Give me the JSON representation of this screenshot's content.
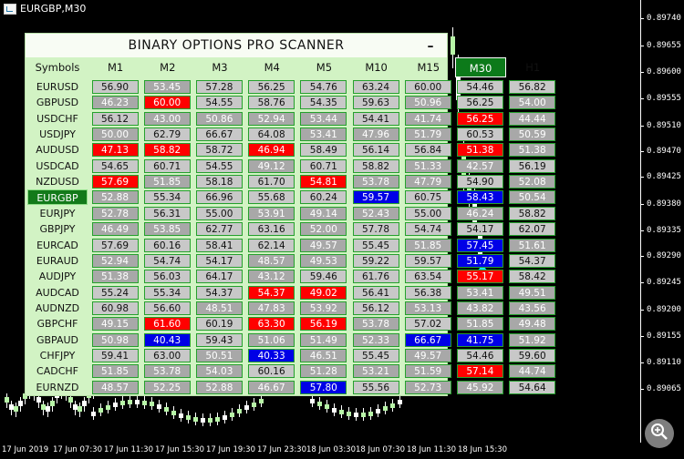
{
  "window": {
    "title": "EURGBP,M30"
  },
  "scanner": {
    "title": "BINARY OPTIONS PRO SCANNER",
    "minimize_label": "–",
    "symbols_header": "Symbols",
    "timeframes": [
      "M1",
      "M2",
      "M3",
      "M4",
      "M5",
      "M10",
      "M15",
      "M30",
      "H1"
    ],
    "active_timeframe": "M30",
    "active_symbol": "EURGBP",
    "rows": [
      {
        "symbol": "EURUSD",
        "values": [
          "56.90",
          "53.45",
          "57.28",
          "56.25",
          "54.76",
          "63.24",
          "60.00",
          "54.46",
          "56.82"
        ],
        "colors": [
          "L",
          "G",
          "L",
          "L",
          "L",
          "L",
          "L",
          "L",
          "L"
        ]
      },
      {
        "symbol": "GBPUSD",
        "values": [
          "46.23",
          "60.00",
          "54.55",
          "58.76",
          "54.35",
          "59.63",
          "50.96",
          "56.25",
          "54.00"
        ],
        "colors": [
          "G",
          "R",
          "L",
          "L",
          "L",
          "L",
          "G",
          "L",
          "G"
        ]
      },
      {
        "symbol": "USDCHF",
        "values": [
          "56.12",
          "43.00",
          "50.86",
          "52.94",
          "53.44",
          "54.41",
          "41.74",
          "56.25",
          "44.44"
        ],
        "colors": [
          "L",
          "G",
          "G",
          "G",
          "G",
          "L",
          "G",
          "R",
          "G"
        ]
      },
      {
        "symbol": "USDJPY",
        "values": [
          "50.00",
          "62.79",
          "66.67",
          "64.08",
          "53.41",
          "47.96",
          "51.79",
          "60.53",
          "50.59"
        ],
        "colors": [
          "G",
          "L",
          "L",
          "L",
          "G",
          "G",
          "G",
          "L",
          "G"
        ]
      },
      {
        "symbol": "AUDUSD",
        "values": [
          "47.13",
          "58.82",
          "58.72",
          "46.94",
          "58.49",
          "56.14",
          "56.84",
          "51.38",
          "51.38"
        ],
        "colors": [
          "R",
          "R",
          "L",
          "R",
          "L",
          "L",
          "L",
          "R",
          "G"
        ]
      },
      {
        "symbol": "USDCAD",
        "values": [
          "54.65",
          "60.71",
          "54.55",
          "49.12",
          "60.71",
          "58.82",
          "51.33",
          "42.57",
          "56.19"
        ],
        "colors": [
          "L",
          "L",
          "L",
          "G",
          "L",
          "L",
          "G",
          "G",
          "L"
        ]
      },
      {
        "symbol": "NZDUSD",
        "values": [
          "57.69",
          "51.85",
          "58.18",
          "61.70",
          "54.81",
          "53.78",
          "47.79",
          "54.90",
          "52.08"
        ],
        "colors": [
          "R",
          "G",
          "L",
          "L",
          "R",
          "G",
          "G",
          "L",
          "G"
        ]
      },
      {
        "symbol": "EURGBP",
        "values": [
          "52.88",
          "55.34",
          "66.96",
          "55.68",
          "60.24",
          "59.57",
          "60.75",
          "58.43",
          "50.54"
        ],
        "colors": [
          "G",
          "L",
          "L",
          "L",
          "L",
          "B",
          "L",
          "B",
          "G"
        ]
      },
      {
        "symbol": "EURJPY",
        "values": [
          "52.78",
          "56.31",
          "55.00",
          "53.91",
          "49.14",
          "52.43",
          "55.00",
          "46.24",
          "58.82"
        ],
        "colors": [
          "G",
          "L",
          "L",
          "G",
          "G",
          "G",
          "L",
          "G",
          "L"
        ]
      },
      {
        "symbol": "GBPJPY",
        "values": [
          "46.49",
          "53.85",
          "62.77",
          "63.16",
          "52.00",
          "57.78",
          "54.74",
          "54.17",
          "62.07"
        ],
        "colors": [
          "G",
          "G",
          "L",
          "L",
          "G",
          "L",
          "L",
          "L",
          "L"
        ]
      },
      {
        "symbol": "EURCAD",
        "values": [
          "57.69",
          "60.16",
          "58.41",
          "62.14",
          "49.57",
          "55.45",
          "51.85",
          "57.45",
          "51.61"
        ],
        "colors": [
          "L",
          "L",
          "L",
          "L",
          "G",
          "L",
          "G",
          "B",
          "G"
        ]
      },
      {
        "symbol": "EURAUD",
        "values": [
          "52.94",
          "54.74",
          "54.17",
          "48.57",
          "49.53",
          "59.22",
          "59.57",
          "51.79",
          "54.37"
        ],
        "colors": [
          "G",
          "L",
          "L",
          "G",
          "G",
          "L",
          "L",
          "B",
          "L"
        ]
      },
      {
        "symbol": "AUDJPY",
        "values": [
          "51.38",
          "56.03",
          "64.17",
          "43.12",
          "59.46",
          "61.76",
          "63.54",
          "55.17",
          "58.42"
        ],
        "colors": [
          "G",
          "L",
          "L",
          "G",
          "L",
          "L",
          "L",
          "R",
          "L"
        ]
      },
      {
        "symbol": "AUDCAD",
        "values": [
          "55.24",
          "55.34",
          "54.37",
          "54.37",
          "49.02",
          "56.41",
          "56.38",
          "53.41",
          "49.51"
        ],
        "colors": [
          "L",
          "L",
          "L",
          "R",
          "R",
          "L",
          "L",
          "G",
          "G"
        ]
      },
      {
        "symbol": "AUDNZD",
        "values": [
          "60.98",
          "56.60",
          "48.51",
          "47.83",
          "53.92",
          "56.12",
          "53.13",
          "43.82",
          "43.56"
        ],
        "colors": [
          "L",
          "L",
          "G",
          "G",
          "G",
          "L",
          "G",
          "G",
          "G"
        ]
      },
      {
        "symbol": "GBPCHF",
        "values": [
          "49.15",
          "61.60",
          "60.19",
          "63.30",
          "56.19",
          "53.78",
          "57.02",
          "51.85",
          "49.48"
        ],
        "colors": [
          "G",
          "R",
          "L",
          "R",
          "R",
          "G",
          "L",
          "G",
          "G"
        ]
      },
      {
        "symbol": "GBPAUD",
        "values": [
          "50.98",
          "40.43",
          "59.43",
          "51.06",
          "51.49",
          "52.33",
          "66.67",
          "41.75",
          "51.92"
        ],
        "colors": [
          "G",
          "B",
          "L",
          "G",
          "G",
          "G",
          "B",
          "B",
          "G"
        ]
      },
      {
        "symbol": "CHFJPY",
        "values": [
          "59.41",
          "63.00",
          "50.51",
          "40.33",
          "46.51",
          "55.45",
          "49.57",
          "54.46",
          "59.60"
        ],
        "colors": [
          "L",
          "L",
          "G",
          "B",
          "G",
          "L",
          "G",
          "L",
          "L"
        ]
      },
      {
        "symbol": "CADCHF",
        "values": [
          "51.85",
          "53.78",
          "54.03",
          "60.16",
          "51.28",
          "53.21",
          "51.59",
          "57.14",
          "44.74"
        ],
        "colors": [
          "G",
          "G",
          "G",
          "L",
          "G",
          "G",
          "G",
          "R",
          "G"
        ]
      },
      {
        "symbol": "EURNZD",
        "values": [
          "48.57",
          "52.25",
          "52.88",
          "46.67",
          "57.80",
          "55.56",
          "52.73",
          "45.92",
          "54.64"
        ],
        "colors": [
          "G",
          "G",
          "G",
          "G",
          "B",
          "L",
          "G",
          "G",
          "L"
        ]
      }
    ]
  },
  "price_axis": [
    "0.89740",
    "0.89655",
    "0.89600",
    "0.89555",
    "0.89510",
    "0.89470",
    "0.89425",
    "0.89380",
    "0.89335",
    "0.89290",
    "0.89245",
    "0.89200",
    "0.89155",
    "0.89110",
    "0.89065"
  ],
  "time_axis": [
    "17 Jun 2019",
    "17 Jun 07:30",
    "17 Jun 11:30",
    "17 Jun 15:30",
    "17 Jun 19:30",
    "17 Jun 23:30",
    "18 Jun 03:30",
    "18 Jun 07:30",
    "18 Jun 11:30",
    "18 Jun 15:30"
  ],
  "colors": {
    "gray_cell": "#a8a8a8",
    "light_cell": "#c8c8c8",
    "red_cell": "#ff0000",
    "blue_cell": "#0000e6",
    "active_green": "#0c7a1a",
    "panel_bg": "#d2f3c4",
    "signal_arrow": "#19e3f7"
  },
  "icons": {
    "zoom": "zoom-in-icon",
    "signal": "up-arrow-icon"
  }
}
